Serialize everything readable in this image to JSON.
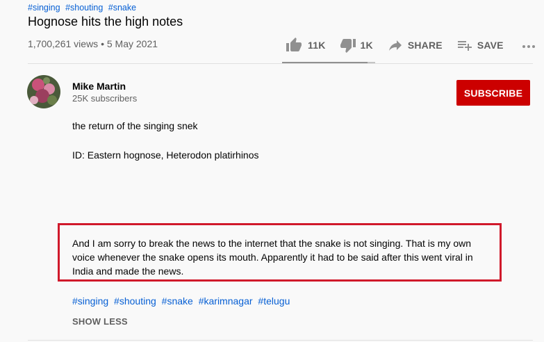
{
  "video": {
    "hashtags_top": [
      "#singing",
      "#shouting",
      "#snake"
    ],
    "title": "Hognose hits the high notes",
    "meta": "1,700,261 views • 5 May 2021"
  },
  "actions": {
    "like_label": "11K",
    "dislike_label": "1K",
    "share_label": "SHARE",
    "save_label": "SAVE",
    "like_ratio": 0.92,
    "icons": [
      "thumb-up-icon",
      "thumb-down-icon",
      "share-icon",
      "playlist-add-icon",
      "more-icon"
    ]
  },
  "channel": {
    "name": "Mike Martin",
    "subscribers": "25K subscribers",
    "subscribe_label": "SUBSCRIBE"
  },
  "description": {
    "line1": "the return of the singing snek",
    "line2": "ID: Eastern hognose, Heterodon platirhinos",
    "highlighted": "And I am sorry to break the news to the internet that the snake is not singing. That is my own voice whenever the snake opens its mouth. Apparently it had to be said after this went viral in India and made the news.",
    "hashtags": [
      "#singing",
      "#shouting",
      "#snake",
      "#karimnagar",
      "#telugu"
    ],
    "show_less_label": "SHOW LESS"
  },
  "colors": {
    "subscribe_bg": "#cc0000",
    "link": "#065fd4",
    "highlight_border": "#d0192b"
  }
}
